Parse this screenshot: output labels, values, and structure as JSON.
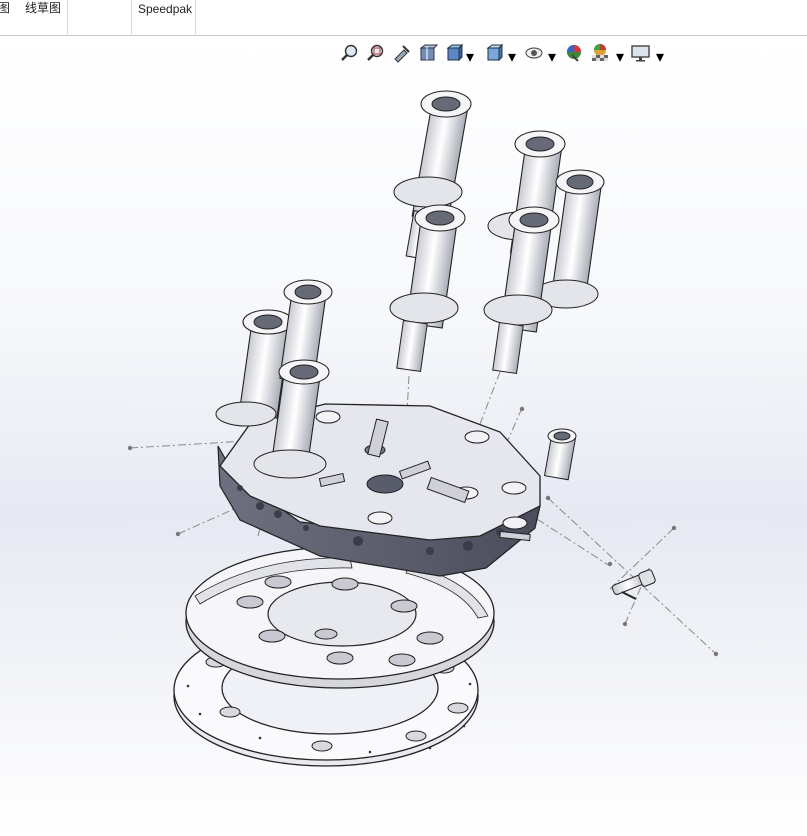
{
  "tabs": [
    {
      "label": "图"
    },
    {
      "label": "线草图"
    },
    {
      "label": "Speedpak"
    }
  ],
  "heads_up_toolbar": {
    "icons": [
      "zoom-to-fit-icon",
      "zoom-to-area-icon",
      "previous-view-icon",
      "section-view-icon",
      "view-orientation-icon",
      "display-style-icon",
      "hide-show-items-icon",
      "edit-appearance-icon",
      "apply-scene-icon",
      "view-settings-icon"
    ]
  },
  "graphics_area": {
    "content": "exploded-assembly-model"
  }
}
